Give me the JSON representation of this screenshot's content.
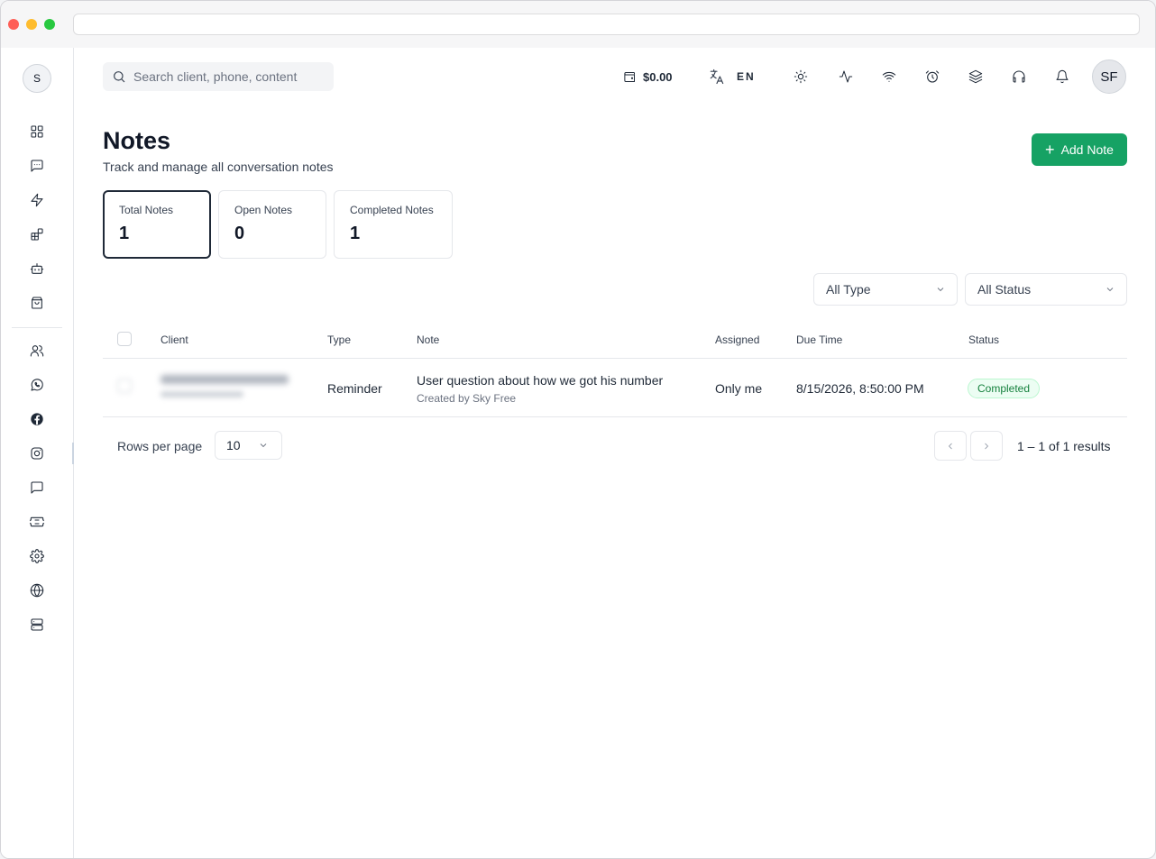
{
  "sidebar": {
    "workspace_initial": "S",
    "items": [
      {
        "icon": "dashboard-icon"
      },
      {
        "icon": "message-square-icon"
      },
      {
        "icon": "lightning-icon"
      },
      {
        "icon": "apps-icon"
      },
      {
        "icon": "bot-icon"
      },
      {
        "icon": "shopping-bag-icon"
      },
      {
        "icon": "users-icon"
      },
      {
        "icon": "whatsapp-icon"
      },
      {
        "icon": "facebook-icon"
      },
      {
        "icon": "instagram-icon"
      },
      {
        "icon": "chat-bubble-icon"
      },
      {
        "icon": "ticket-icon"
      },
      {
        "icon": "settings-icon"
      },
      {
        "icon": "globe-icon"
      },
      {
        "icon": "server-icon"
      }
    ]
  },
  "header": {
    "search_placeholder": "Search client, phone, content",
    "balance": "$0.00",
    "language": "EN",
    "icons": [
      "sun-icon",
      "activity-icon",
      "wifi-icon",
      "alarm-clock-icon",
      "layers-icon",
      "headphones-icon",
      "bell-icon"
    ],
    "user_initials": "SF"
  },
  "page": {
    "title": "Notes",
    "subtitle": "Track and manage all conversation notes",
    "add_button": "Add Note"
  },
  "stats": [
    {
      "label": "Total Notes",
      "value": "1"
    },
    {
      "label": "Open Notes",
      "value": "0"
    },
    {
      "label": "Completed Notes",
      "value": "1"
    }
  ],
  "filters": {
    "type": "All Type",
    "status": "All Status"
  },
  "table": {
    "columns": [
      "Client",
      "Type",
      "Note",
      "Assigned",
      "Due Time",
      "Status"
    ],
    "rows": [
      {
        "type": "Reminder",
        "note": "User question about how we got his number",
        "note_sub": "Created by Sky Free",
        "assigned": "Only me",
        "due_time": "8/15/2026, 8:50:00 PM",
        "status": "Completed"
      }
    ]
  },
  "pagination": {
    "rows_label": "Rows per page",
    "rows_value": "10",
    "results": "1 – 1 of 1 results"
  }
}
